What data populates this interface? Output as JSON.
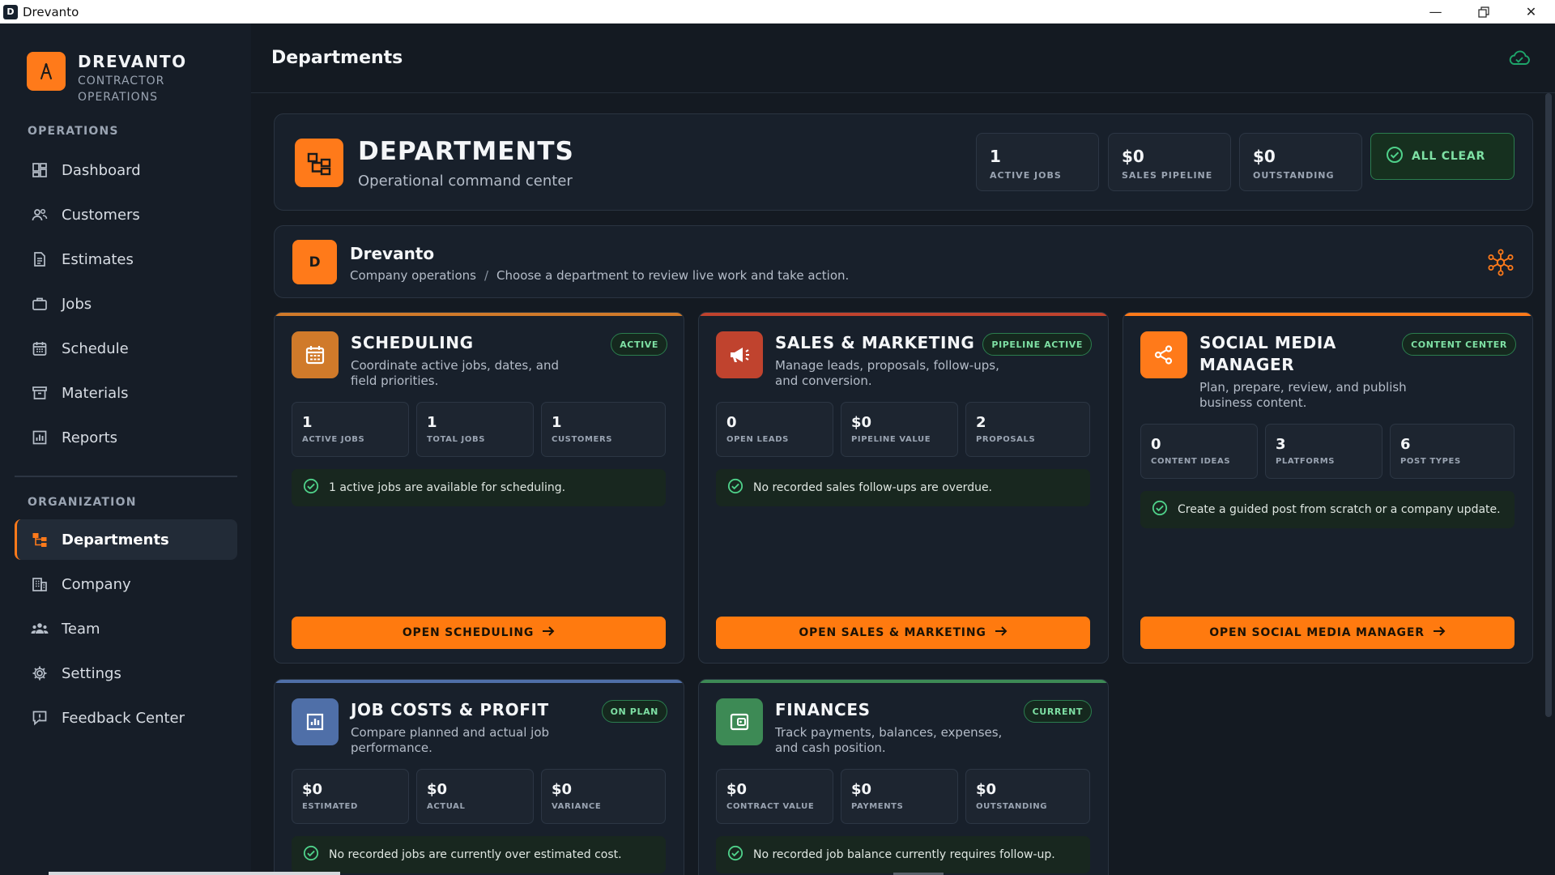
{
  "window": {
    "title": "Drevanto",
    "app_letter": "D"
  },
  "brand": {
    "name": "DREVANTO",
    "sub1": "CONTRACTOR",
    "sub2": "OPERATIONS"
  },
  "sidebar": {
    "section_operations": "OPERATIONS",
    "section_organization": "ORGANIZATION",
    "items": [
      {
        "label": "Dashboard",
        "icon": "dashboard-icon"
      },
      {
        "label": "Customers",
        "icon": "customers-icon"
      },
      {
        "label": "Estimates",
        "icon": "document-icon"
      },
      {
        "label": "Jobs",
        "icon": "briefcase-icon"
      },
      {
        "label": "Schedule",
        "icon": "calendar-icon"
      },
      {
        "label": "Materials",
        "icon": "box-icon"
      },
      {
        "label": "Reports",
        "icon": "chart-icon"
      },
      {
        "label": "Departments",
        "icon": "org-chart-icon",
        "active": true
      },
      {
        "label": "Company",
        "icon": "building-icon"
      },
      {
        "label": "Team",
        "icon": "team-icon"
      },
      {
        "label": "Settings",
        "icon": "gear-icon"
      },
      {
        "label": "Feedback Center",
        "icon": "feedback-icon"
      }
    ]
  },
  "header": {
    "title": "Departments"
  },
  "hero": {
    "title": "DEPARTMENTS",
    "subtitle": "Operational command center",
    "stats": [
      {
        "value": "1",
        "label": "ACTIVE JOBS"
      },
      {
        "value": "$0",
        "label": "SALES PIPELINE"
      },
      {
        "value": "$0",
        "label": "OUTSTANDING"
      }
    ],
    "status": "ALL CLEAR"
  },
  "company": {
    "badge": "D",
    "name": "Drevanto",
    "crumb1": "Company operations",
    "crumb_sep": "/",
    "crumb2": "Choose a department to review live work and take action."
  },
  "cards": [
    {
      "title": "SCHEDULING",
      "desc": "Coordinate active jobs, dates, and field priorities.",
      "badge": "ACTIVE",
      "stats": [
        {
          "value": "1",
          "label": "ACTIVE JOBS"
        },
        {
          "value": "1",
          "label": "TOTAL JOBS"
        },
        {
          "value": "1",
          "label": "CUSTOMERS"
        }
      ],
      "note": "1 active jobs are available for scheduling.",
      "button": "OPEN SCHEDULING",
      "accent": "#d07a2a"
    },
    {
      "title": "SALES & MARKETING",
      "desc": "Manage leads, proposals, follow-ups, and conversion.",
      "badge": "PIPELINE ACTIVE",
      "stats": [
        {
          "value": "0",
          "label": "OPEN LEADS"
        },
        {
          "value": "$0",
          "label": "PIPELINE VALUE"
        },
        {
          "value": "2",
          "label": "PROPOSALS"
        }
      ],
      "note": "No recorded sales follow-ups are overdue.",
      "button": "OPEN SALES & MARKETING",
      "accent": "#c0432e"
    },
    {
      "title": "SOCIAL MEDIA MANAGER",
      "desc": "Plan, prepare, review, and publish business content.",
      "badge": "CONTENT CENTER",
      "stats": [
        {
          "value": "0",
          "label": "CONTENT IDEAS"
        },
        {
          "value": "3",
          "label": "PLATFORMS"
        },
        {
          "value": "6",
          "label": "POST TYPES"
        }
      ],
      "note": "Create a guided post from scratch or a company update.",
      "button": "OPEN SOCIAL MEDIA MANAGER",
      "accent": "#ff7a1a"
    },
    {
      "title": "JOB COSTS & PROFIT",
      "desc": "Compare planned and actual job performance.",
      "badge": "ON PLAN",
      "stats": [
        {
          "value": "$0",
          "label": "ESTIMATED"
        },
        {
          "value": "$0",
          "label": "ACTUAL"
        },
        {
          "value": "$0",
          "label": "VARIANCE"
        }
      ],
      "note": "No recorded jobs are currently over estimated cost.",
      "accent": "#4f6fa8"
    },
    {
      "title": "FINANCES",
      "desc": "Track payments, balances, expenses, and cash position.",
      "badge": "CURRENT",
      "stats": [
        {
          "value": "$0",
          "label": "CONTRACT VALUE"
        },
        {
          "value": "$0",
          "label": "PAYMENTS"
        },
        {
          "value": "$0",
          "label": "OUTSTANDING"
        }
      ],
      "note": "No recorded job balance currently requires follow-up.",
      "accent": "#3d8a55"
    }
  ]
}
